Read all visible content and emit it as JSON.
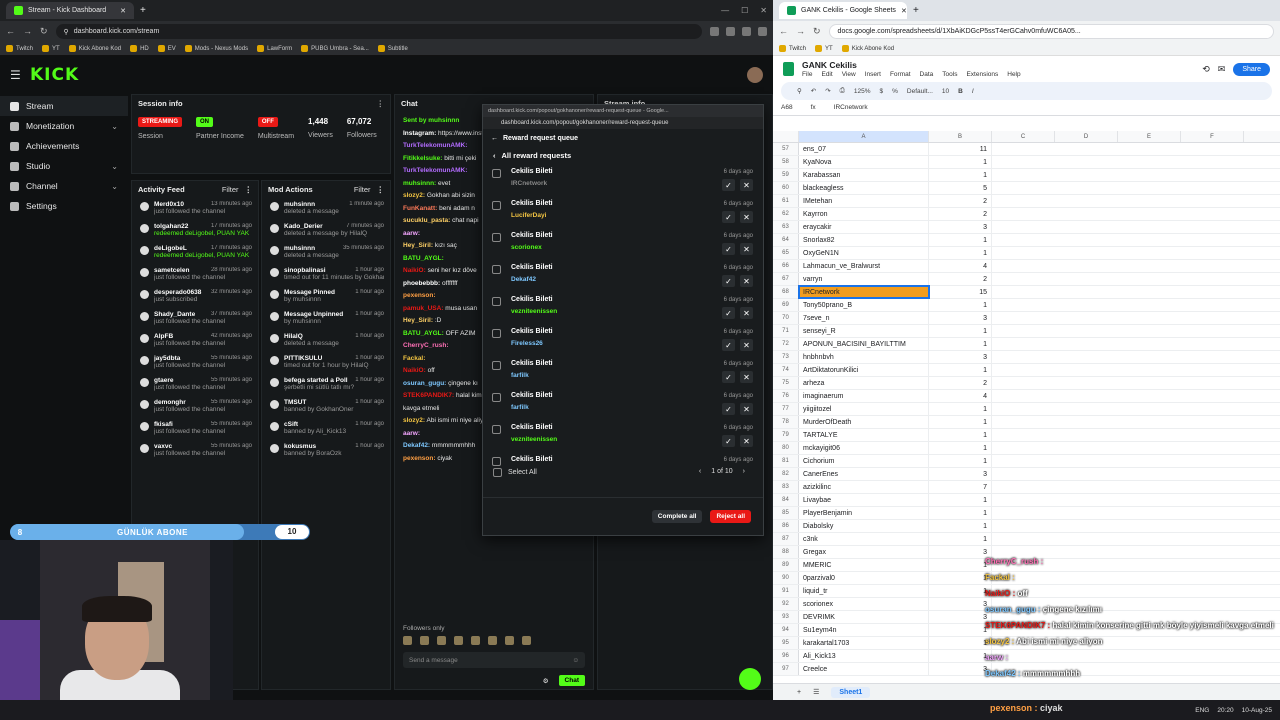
{
  "left_browser": {
    "tab_title": "Stream - Kick Dashboard",
    "url": "dashboard.kick.com/stream",
    "bookmarks": [
      "Twitch",
      "YT",
      "Kick Abone Kod",
      "HD",
      "EV",
      "Mods - Nexus Mods",
      "LawForm",
      "PUBG Umbra - Sea...",
      "Subtitle"
    ]
  },
  "kick": {
    "nav": [
      {
        "label": "Stream",
        "chevron": ""
      },
      {
        "label": "Monetization",
        "chevron": "⌄"
      },
      {
        "label": "Achievements",
        "chevron": ""
      },
      {
        "label": "Studio",
        "chevron": "⌄"
      },
      {
        "label": "Channel",
        "chevron": "⌄"
      },
      {
        "label": "Settings",
        "chevron": ""
      }
    ],
    "session": {
      "title": "Session info",
      "cells": [
        {
          "badge": "STREAMING",
          "label": "Session"
        },
        {
          "badge": "ON",
          "label": "Partner Income"
        },
        {
          "badge": "OFF",
          "label": "Multistream"
        },
        {
          "value": "1,448",
          "label": "Viewers"
        },
        {
          "value": "67,072",
          "label": "Followers"
        }
      ]
    },
    "activity": {
      "title": "Activity Feed",
      "filter": "Filter",
      "items": [
        {
          "name": "Merd0x10",
          "time": "13 minutes ago",
          "sub": "just followed the channel"
        },
        {
          "name": "tolgahan22",
          "time": "17 minutes ago",
          "sub": "redeemed deLigobel, PUAN YAK"
        },
        {
          "name": "deLigobeL",
          "time": "17 minutes ago",
          "sub": "redeemed deLigobel, PUAN YAK"
        },
        {
          "name": "sametcelen",
          "time": "28 minutes ago",
          "sub": "just followed the channel"
        },
        {
          "name": "desperado0638",
          "time": "32 minutes ago",
          "sub": "just subscribed"
        },
        {
          "name": "Shady_Dante",
          "time": "37 minutes ago",
          "sub": "just followed the channel"
        },
        {
          "name": "AlpFB",
          "time": "42 minutes ago",
          "sub": "just followed the channel"
        },
        {
          "name": "jay5dbta",
          "time": "55 minutes ago",
          "sub": "just followed the channel"
        },
        {
          "name": "gtaere",
          "time": "55 minutes ago",
          "sub": "just followed the channel"
        },
        {
          "name": "demonghr",
          "time": "55 minutes ago",
          "sub": "just followed the channel"
        },
        {
          "name": "fkisafi",
          "time": "55 minutes ago",
          "sub": "just followed the channel"
        },
        {
          "name": "vaxvc",
          "time": "55 minutes ago",
          "sub": "just followed the channel"
        }
      ]
    },
    "mod": {
      "title": "Mod Actions",
      "filter": "Filter",
      "items": [
        {
          "name": "muhsinnn",
          "time": "1 minute ago",
          "sub": "deleted a message"
        },
        {
          "name": "Kado_Derier",
          "time": "7 minutes ago",
          "sub": "deleted a message by HilalQ"
        },
        {
          "name": "muhsinnn",
          "time": "35 minutes ago",
          "sub": "deleted a message"
        },
        {
          "name": "sinopbalinasi",
          "time": "1 hour ago",
          "sub": "timed out for 11 minutes by GokhanOner"
        },
        {
          "name": "Message Pinned",
          "time": "1 hour ago",
          "sub": "by muhsinnn"
        },
        {
          "name": "Message Unpinned",
          "time": "1 hour ago",
          "sub": "by muhsinnn"
        },
        {
          "name": "HilalQ",
          "time": "1 hour ago",
          "sub": "deleted a message"
        },
        {
          "name": "PITTIKSULU",
          "time": "1 hour ago",
          "sub": "timed out for 1 hour by HilalQ"
        },
        {
          "name": "befega started a Poll",
          "time": "1 hour ago",
          "sub": "şerbetli mi sütlü tatlı mı?"
        },
        {
          "name": "TMSUT",
          "time": "1 hour ago",
          "sub": "banned by GokhanOner"
        },
        {
          "name": "cSift",
          "time": "1 hour ago",
          "sub": "banned by Ali_Kick13"
        },
        {
          "name": "kokusmus",
          "time": "1 hour ago",
          "sub": "banned by BoraOzk"
        }
      ]
    },
    "chat": {
      "title": "Chat",
      "lines": [
        {
          "u": "Sent by muhsinnn",
          "c": "#53fc18",
          "m": ""
        },
        {
          "u": "Instagram:",
          "c": "#ffffff",
          "m": "https://www.instagram..."
        },
        {
          "u": "TurkTelekomunAMK:",
          "c": "#b36cff",
          "m": ""
        },
        {
          "u": "Fitikkelsuke:",
          "c": "#53fc18",
          "m": "bitti mi çeki"
        },
        {
          "u": "TurkTelekomunAMK:",
          "c": "#b36cff",
          "m": ""
        },
        {
          "u": "muhsinnn:",
          "c": "#53fc18",
          "m": "evet"
        },
        {
          "u": "slozy2:",
          "c": "#f4c542",
          "m": "Gokhan abi sizin"
        },
        {
          "u": "FunKanatt:",
          "c": "#ff7a59",
          "m": "beni adam n"
        },
        {
          "u": "sucuklu_pasta:",
          "c": "#ffd166",
          "m": "chat napi"
        },
        {
          "u": "aarw:",
          "c": "#f4a6ff",
          "m": ""
        },
        {
          "u": "Hey_Siril:",
          "c": "#ffd166",
          "m": "kızı saç"
        },
        {
          "u": "BATU_AYGL:",
          "c": "#53fc18",
          "m": ""
        },
        {
          "u": "NaikiO:",
          "c": "#e91916",
          "m": "seni her kız döve"
        },
        {
          "u": "phoebebbb:",
          "c": "#ffffff",
          "m": "offfffff"
        },
        {
          "u": "pexenson:",
          "c": "#ff9f43",
          "m": ""
        },
        {
          "u": "pamuk_USA:",
          "c": "#e91916",
          "m": "musa usan"
        },
        {
          "u": "Hey_Siril:",
          "c": "#ffd166",
          "m": ":D"
        },
        {
          "u": "BATU_AYGL:",
          "c": "#53fc18",
          "m": "OFF AZIM"
        },
        {
          "u": "CherryC_rush:",
          "c": "#ff6fb5",
          "m": ""
        },
        {
          "u": "Fackal:",
          "c": "#f4c542",
          "m": ""
        },
        {
          "u": "NaikiO:",
          "c": "#e91916",
          "m": "off"
        },
        {
          "u": "osuran_gugu:",
          "c": "#7ec8ff",
          "m": "çingene kı"
        },
        {
          "u": "STEK6PANDIK7:",
          "c": "#e91916",
          "m": "halal kimin konserine gitti mk böyle yiyismeli kavga etmeli"
        },
        {
          "u": "slozy2:",
          "c": "#f4c542",
          "m": "Abi ismi mi niye aliyon"
        },
        {
          "u": "aarw:",
          "c": "#f4a6ff",
          "m": ""
        },
        {
          "u": "Dekaf42:",
          "c": "#7ec8ff",
          "m": "mmmmmmhhh"
        },
        {
          "u": "pexenson:",
          "c": "#ff9f43",
          "m": "ciyak"
        }
      ],
      "followers_only": "Followers only",
      "placeholder": "Send a message",
      "send_label": "Chat"
    },
    "stream_info_title": "Stream info"
  },
  "popup": {
    "tab_title": "dashboard.kick.com/popout/gokhanoner/reward-request-queue - Google...",
    "url": "dashboard.kick.com/popout/gokhanoner/reward-request-queue",
    "title": "Reward request queue",
    "back_label": "All reward requests",
    "requests": [
      {
        "title": "Cekilis Bileti",
        "time": "6 days ago",
        "user": "IRCnetwork",
        "color": "#888888"
      },
      {
        "title": "Cekilis Bileti",
        "time": "6 days ago",
        "user": "LuciferDayi",
        "color": "#f4c542"
      },
      {
        "title": "Cekilis Bileti",
        "time": "6 days ago",
        "user": "scorionex",
        "color": "#53fc18"
      },
      {
        "title": "Cekilis Bileti",
        "time": "6 days ago",
        "user": "Dekaf42",
        "color": "#7ec8ff"
      },
      {
        "title": "Cekilis Bileti",
        "time": "6 days ago",
        "user": "vezniteenissen",
        "color": "#53fc18"
      },
      {
        "title": "Cekilis Bileti",
        "time": "6 days ago",
        "user": "Fireless26",
        "color": "#7ec8ff"
      },
      {
        "title": "Cekilis Bileti",
        "time": "6 days ago",
        "user": "farfilk",
        "color": "#7ec8ff"
      },
      {
        "title": "Cekilis Bileti",
        "time": "6 days ago",
        "user": "farfilk",
        "color": "#7ec8ff"
      },
      {
        "title": "Cekilis Bileti",
        "time": "6 days ago",
        "user": "vezniteenissen",
        "color": "#53fc18"
      },
      {
        "title": "Cekilis Bileti",
        "time": "6 days ago",
        "user": "",
        "color": "#53fc18"
      }
    ],
    "select_all": "Select All",
    "page": "1 of 10",
    "complete_all": "Complete all",
    "reject_all": "Reject all"
  },
  "right_browser": {
    "tab_title": "GANK Cekilis - Google Sheets",
    "url": "docs.google.com/spreadsheets/d/1XbAiKDGcP5ssT4erGCahv0mfuWC6A05..."
  },
  "sheets": {
    "title": "GANK Cekilis",
    "menu": [
      "File",
      "Edit",
      "View",
      "Insert",
      "Format",
      "Data",
      "Tools",
      "Extensions",
      "Help"
    ],
    "share": "Share",
    "zoom": "125%",
    "font": "Default...",
    "font_size": "10",
    "cell_ref": "A68",
    "formula": "IRCnetwork",
    "columns": [
      "A",
      "B",
      "C",
      "D",
      "E",
      "F"
    ],
    "rows": [
      [
        "57",
        "ens_07",
        "11"
      ],
      [
        "58",
        "KyaNova",
        "1"
      ],
      [
        "59",
        "Karabassan",
        "1"
      ],
      [
        "60",
        "blackeagless",
        "5"
      ],
      [
        "61",
        "IMetehan",
        "2"
      ],
      [
        "62",
        "Kayrron",
        "2"
      ],
      [
        "63",
        "eraycakir",
        "3"
      ],
      [
        "64",
        "Snorlax82",
        "1"
      ],
      [
        "65",
        "OxyGeN1N",
        "1"
      ],
      [
        "66",
        "Lahmacun_ve_Bralwurst",
        "4"
      ],
      [
        "67",
        "varryn",
        "2"
      ],
      [
        "68",
        "IRCnetwork",
        "15"
      ],
      [
        "69",
        "Tony50prano_B",
        "1"
      ],
      [
        "70",
        "7seve_n",
        "3"
      ],
      [
        "71",
        "senseyi_R",
        "1"
      ],
      [
        "72",
        "APONUN_BACISINI_BAYILTTIM",
        "1"
      ],
      [
        "73",
        "hnbhnbvh",
        "3"
      ],
      [
        "74",
        "ArtDiktatorunKilici",
        "1"
      ],
      [
        "75",
        "arheza",
        "2"
      ],
      [
        "76",
        "imaginaerum",
        "4"
      ],
      [
        "77",
        "yiigiitozel",
        "1"
      ],
      [
        "78",
        "MurderOfDeath",
        "1"
      ],
      [
        "79",
        "TARTALYE",
        "1"
      ],
      [
        "80",
        "mckayigit06",
        "1"
      ],
      [
        "81",
        "Cichorium",
        "1"
      ],
      [
        "82",
        "CanerEnes",
        "3"
      ],
      [
        "83",
        "azizkilinc",
        "7"
      ],
      [
        "84",
        "Livaybae",
        "1"
      ],
      [
        "85",
        "PlayerBenjamin",
        "1"
      ],
      [
        "86",
        "Diabolsky",
        "1"
      ],
      [
        "87",
        "c3nk",
        "1"
      ],
      [
        "88",
        "Gregax",
        "3"
      ],
      [
        "89",
        "MMERIC",
        "1"
      ],
      [
        "90",
        "0parzival0",
        "1"
      ],
      [
        "91",
        "liquid_tr",
        "1"
      ],
      [
        "92",
        "scorionex",
        "3"
      ],
      [
        "93",
        "DEVRIMK",
        "3"
      ],
      [
        "94",
        "Su1eym4n",
        "1"
      ],
      [
        "95",
        "karakartal1703",
        "1"
      ],
      [
        "96",
        "Ali_Kick13",
        "1"
      ],
      [
        "97",
        "Creelce",
        "3"
      ]
    ],
    "sheet_tab": "Sheet1"
  },
  "overlay_chat": [
    {
      "u": "CherryC_rush :",
      "m": "",
      "c": "#ff6fb5"
    },
    {
      "u": "Fackal :",
      "m": "",
      "c": "#f4c542"
    },
    {
      "u": "NaikiO :",
      "m": "off",
      "c": "#e91916"
    },
    {
      "u": "osuran_gugu :",
      "m": "çingene kızılımı",
      "c": "#7ec8ff"
    },
    {
      "u": "STEK6PANDIK7 :",
      "m": "halal kimin konserine gitti mk böyle yiyismeli kavga etmeli",
      "c": "#e91916"
    },
    {
      "u": "slozy2 :",
      "m": "Abi ismi mi niye aliyon",
      "c": "#f4c542"
    },
    {
      "u": "aarw :",
      "m": "",
      "c": "#f4a6ff"
    },
    {
      "u": "Dekaf42 :",
      "m": "mmmmmmhhh",
      "c": "#7ec8ff"
    }
  ],
  "sub_goal": {
    "level": "8",
    "label": "GÜNLÜK ABONE",
    "goal": "10",
    "progress": 0.78
  },
  "taskbar": {
    "bottom_chat_user": "pexenson :",
    "bottom_chat_msg": "ciyak",
    "lang": "ENG",
    "time": "20:20",
    "date": "10-Aug-25"
  }
}
